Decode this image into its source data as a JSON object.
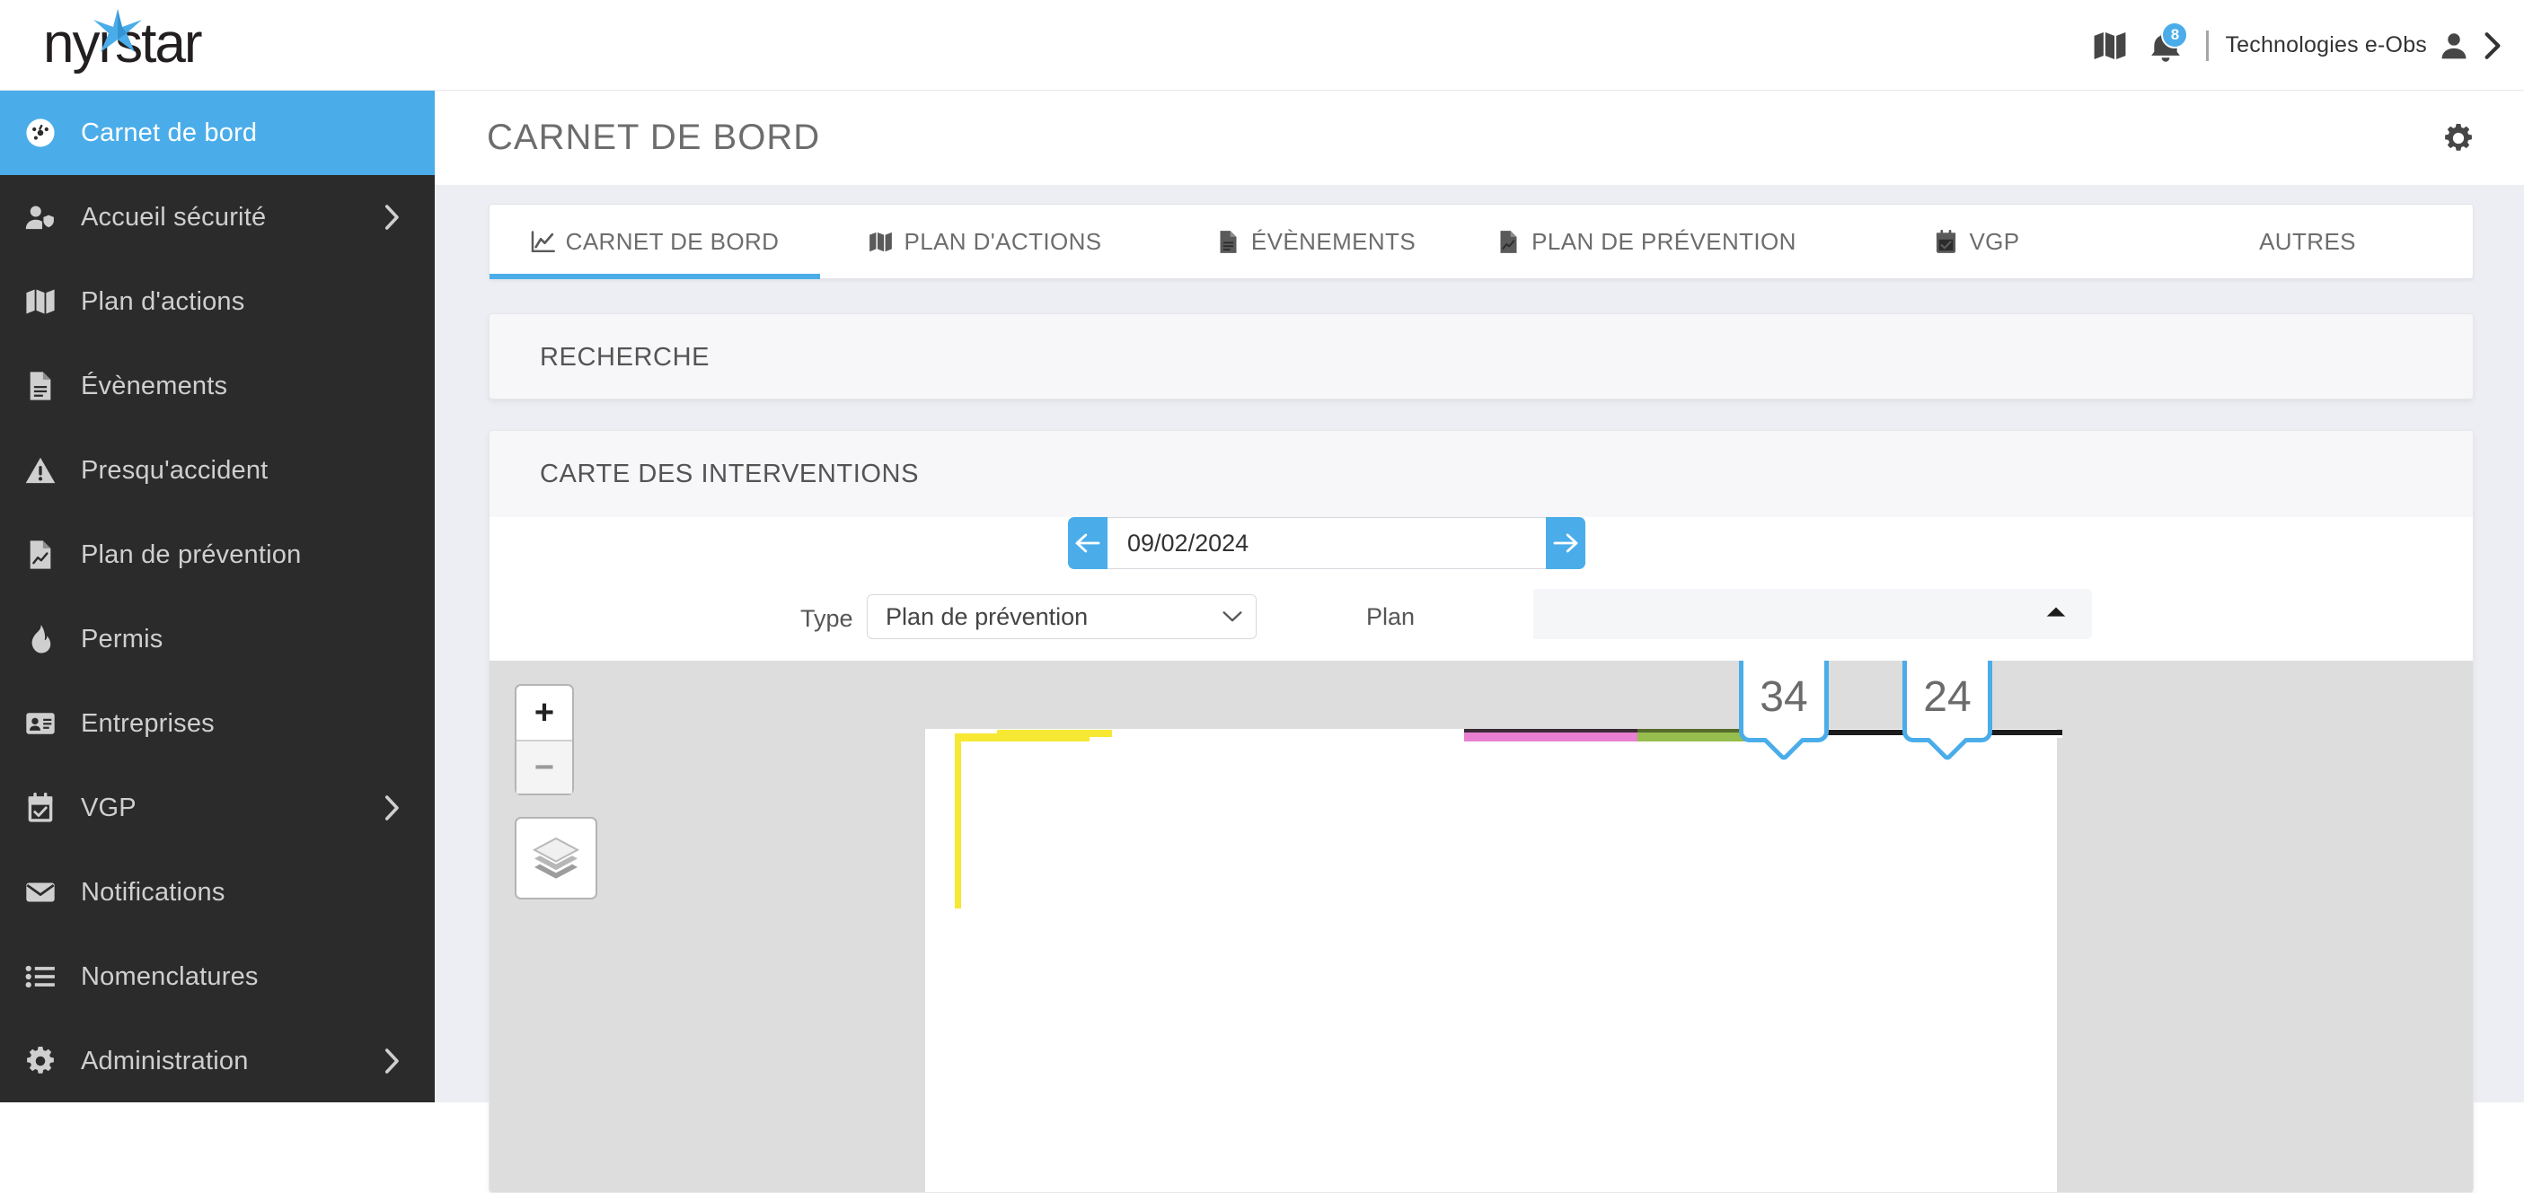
{
  "brand": {
    "name": "nyrstar",
    "accent": "#4aadea",
    "star_icon": "star-icon"
  },
  "header": {
    "map_icon": "map-icon",
    "bell_icon": "bell-icon",
    "notification_count": "8",
    "user_name": "Technologies e-Obs",
    "person_icon": "person-icon",
    "chevron_icon": "chevron-right-icon"
  },
  "sidebar": {
    "items": [
      {
        "label": "Carnet de bord",
        "icon": "dashboard-icon",
        "active": true,
        "chevron": false
      },
      {
        "label": "Accueil sécurité",
        "icon": "user-shield-icon",
        "active": false,
        "chevron": true
      },
      {
        "label": "Plan d'actions",
        "icon": "map-icon",
        "active": false,
        "chevron": false
      },
      {
        "label": "Évènements",
        "icon": "document-icon",
        "active": false,
        "chevron": false
      },
      {
        "label": "Presqu'accident",
        "icon": "warning-icon",
        "active": false,
        "chevron": false
      },
      {
        "label": "Plan de prévention",
        "icon": "file-chart-icon",
        "active": false,
        "chevron": false
      },
      {
        "label": "Permis",
        "icon": "flame-icon",
        "active": false,
        "chevron": false
      },
      {
        "label": "Entreprises",
        "icon": "id-card-icon",
        "active": false,
        "chevron": false
      },
      {
        "label": "VGP",
        "icon": "calendar-check-icon",
        "active": false,
        "chevron": true
      },
      {
        "label": "Notifications",
        "icon": "envelope-icon",
        "active": false,
        "chevron": false
      },
      {
        "label": "Nomenclatures",
        "icon": "list-icon",
        "active": false,
        "chevron": false
      },
      {
        "label": "Administration",
        "icon": "gear-icon",
        "active": false,
        "chevron": true
      }
    ]
  },
  "page": {
    "title": "CARNET DE BORD",
    "settings_icon": "gear-icon"
  },
  "tabs": [
    {
      "label": "CARNET DE BORD",
      "icon": "chart-line-icon",
      "active": true
    },
    {
      "label": "PLAN D'ACTIONS",
      "icon": "map-icon",
      "active": false
    },
    {
      "label": "ÉVÈNEMENTS",
      "icon": "document-icon",
      "active": false
    },
    {
      "label": "PLAN DE PRÉVENTION",
      "icon": "file-chart-icon",
      "active": false
    },
    {
      "label": "VGP",
      "icon": "calendar-check-icon",
      "active": false
    },
    {
      "label": "AUTRES",
      "icon": "",
      "active": false
    }
  ],
  "panels": {
    "recherche": {
      "title": "RECHERCHE"
    },
    "carte": {
      "title": "CARTE DES INTERVENTIONS"
    }
  },
  "date_nav": {
    "prev_icon": "arrow-left-icon",
    "next_icon": "arrow-right-icon",
    "value": "09/02/2024"
  },
  "filters": {
    "type": {
      "label": "Type",
      "value": "Plan de prévention",
      "options": [
        "Plan de prévention"
      ],
      "chevron_icon": "chevron-down-icon"
    },
    "plan": {
      "label": "Plan",
      "value": "",
      "chevron_icon": "chevron-up-icon"
    }
  },
  "map": {
    "zoom_in_label": "+",
    "zoom_out_label": "−",
    "zoom_in_icon": "plus-icon",
    "zoom_out_icon": "minus-icon",
    "layers_icon": "layers-icon",
    "markers": [
      {
        "value": "34"
      },
      {
        "value": "24"
      }
    ],
    "zone_colors": {
      "yellow": "#f7e833",
      "pink": "#e87fd1",
      "green": "#96bd4e",
      "black": "#1c1c1c"
    }
  }
}
